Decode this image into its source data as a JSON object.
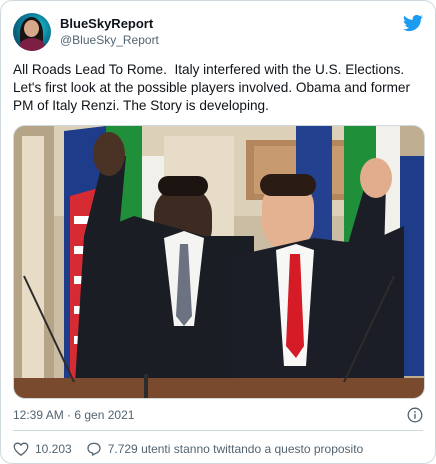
{
  "tweet": {
    "display_name": "BlueSkyReport",
    "handle": "@BlueSky_Report",
    "text": "All Roads Lead To Rome.  Italy interfered with the U.S. Elections.  Let's first look at the possible players involved. Obama and former PM of Italy Renzi. The Story is developing.",
    "timestamp": "12:39 AM · 6 gen 2021",
    "likes": "10.203",
    "reply_text": "7.729 utenti stanno twittando a questo proposito"
  },
  "icons": {
    "brand": "twitter-bird-icon",
    "info": "info-icon",
    "like": "heart-icon",
    "reply": "speech-bubble-icon"
  },
  "colors": {
    "brand_blue": "#1d9bf0",
    "secondary_text": "#536471",
    "border": "#cfd9de"
  }
}
